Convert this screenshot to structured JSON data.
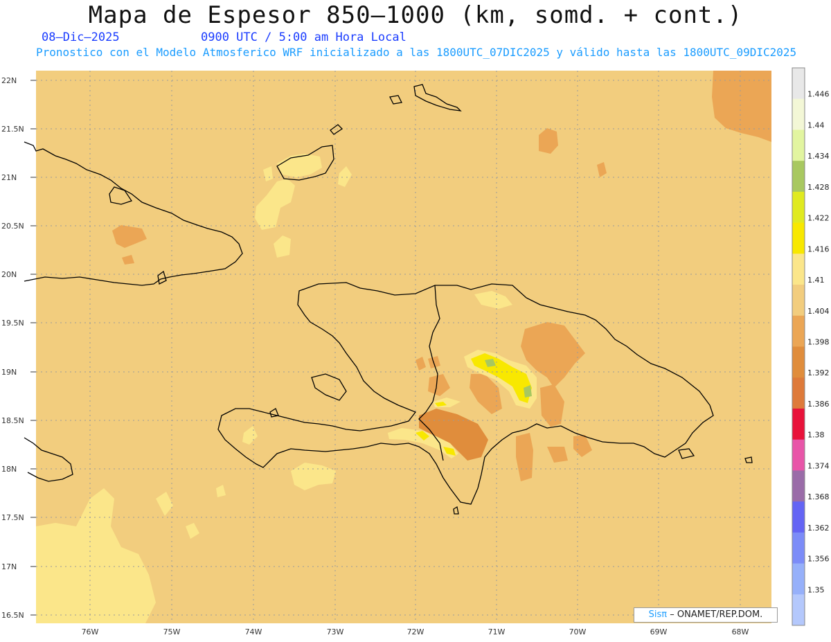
{
  "title": "Mapa de Espesor 850–1000 (km, somd. + cont.)",
  "date": "08–Dic–2025",
  "time": "0900 UTC / 5:00 am Hora Local",
  "subtitle": "Pronostico con el Modelo Atmosferico WRF inicializado a las 1800UTC_07DIC2025 y válido hasta las  1800UTC_09DIC2025",
  "lat_labels": [
    "22N",
    "21.5N",
    "21N",
    "20.5N",
    "20N",
    "19.5N",
    "19N",
    "18.5N",
    "18N",
    "17.5N",
    "17N",
    "16.5N"
  ],
  "lon_labels": [
    "76W",
    "75W",
    "74W",
    "73W",
    "72W",
    "71W",
    "70W",
    "69W",
    "68W"
  ],
  "colorbar": {
    "labels": [
      "1.446",
      "1.44",
      "1.434",
      "1.428",
      "1.422",
      "1.416",
      "1.41",
      "1.404",
      "1.398",
      "1.392",
      "1.386",
      "1.38",
      "1.374",
      "1.368",
      "1.362",
      "1.356",
      "1.35"
    ],
    "colors": [
      "#e8e8e8",
      "#f3f7d6",
      "#e2f5a0",
      "#a8c860",
      "#e0ea20",
      "#f8e800",
      "#fbe68a",
      "#f2cd7e",
      "#eba655",
      "#e08d3c",
      "#de7a3a",
      "#e8123a",
      "#e855a8",
      "#9a6ca8",
      "#6464f4",
      "#7c8cf8",
      "#96b0fa",
      "#b4c8fc"
    ]
  },
  "credit_brand": "Sisπ",
  "credit_text": "– ONAMET/REP.DOM."
}
